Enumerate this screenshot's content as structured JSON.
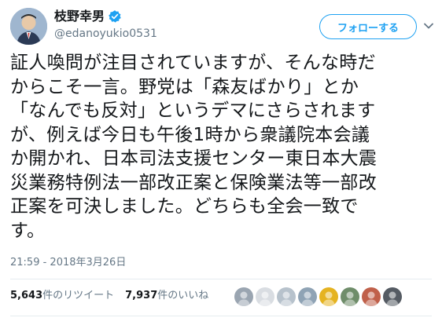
{
  "user": {
    "display_name": "枝野幸男",
    "handle": "@edanoyukio0531"
  },
  "follow_button": {
    "label": "フォローする"
  },
  "tweet": {
    "lines": [
      "証人喚問が注目されていますが、そんな時だ",
      "からこそ一言。野党は「森友ばかり」とか",
      "「なんでも反対」というデマにさらされます",
      "が、例えば今日も午後1時から衆議院本会議",
      "か開かれ、日本司法支援センター東日本大震",
      "災業務特例法一部改正案と保険業法等一部改",
      "正案を可決しました。どちらも全会一致で",
      "す。"
    ],
    "timestamp": "21:59 - 2018年3月26日"
  },
  "stats": {
    "retweets_count": "5,643",
    "retweets_label": "件のリツイート",
    "likes_count": "7,937",
    "likes_label": "件のいいね"
  },
  "facepile_colors": [
    "#9aa5b1",
    "#d9dde2",
    "#b7c2cc",
    "#8fa3b5",
    "#e5b321",
    "#6f8d6a",
    "#c0604a",
    "#555b63"
  ],
  "colors": {
    "accent": "#1da1f2",
    "text": "#14171a",
    "secondary_text": "#657786"
  }
}
